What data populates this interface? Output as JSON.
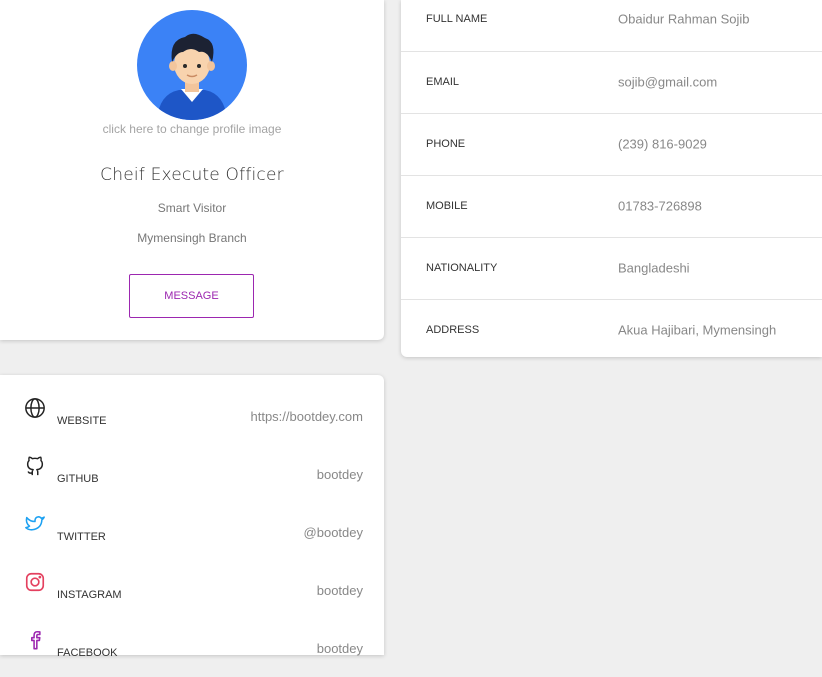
{
  "profile": {
    "change_image_text": "click here to change profile image",
    "role": "Cheif Execute Officer",
    "company": "Smart Visitor",
    "branch": "Mymensingh Branch",
    "message_button": "MESSAGE"
  },
  "details": [
    {
      "label": "FULL NAME",
      "value": "Obaidur Rahman Sojib"
    },
    {
      "label": "EMAIL",
      "value": "sojib@gmail.com"
    },
    {
      "label": "PHONE",
      "value": "(239) 816-9029"
    },
    {
      "label": "MOBILE",
      "value": "01783-726898"
    },
    {
      "label": "NATIONALITY",
      "value": "Bangladeshi"
    },
    {
      "label": "ADDRESS",
      "value": "Akua Hajibari, Mymensingh"
    }
  ],
  "social": [
    {
      "icon": "globe-icon",
      "name": "WEBSITE",
      "value": "https://bootdey.com",
      "color": "#222222"
    },
    {
      "icon": "github-icon",
      "name": "GITHUB",
      "value": "bootdey",
      "color": "#222222"
    },
    {
      "icon": "twitter-icon",
      "name": "TWITTER",
      "value": "@bootdey",
      "color": "#1da1f2"
    },
    {
      "icon": "instagram-icon",
      "name": "INSTAGRAM",
      "value": "bootdey",
      "color": "#e4405f"
    },
    {
      "icon": "facebook-icon",
      "name": "FACEBOOK",
      "value": "bootdey",
      "color": "#9c27b0"
    }
  ],
  "colors": {
    "accent": "#9c27b0",
    "avatar_bg": "#3b82f6",
    "page_bg": "#efefef"
  }
}
